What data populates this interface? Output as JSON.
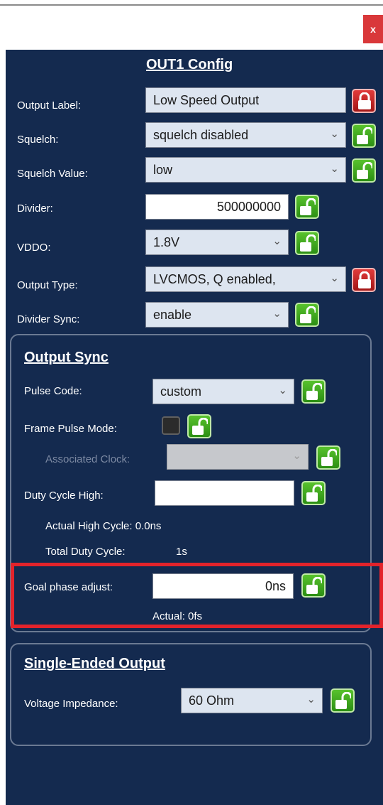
{
  "window": {
    "close_label": "x"
  },
  "panel": {
    "title": "OUT1 Config"
  },
  "fields": {
    "output_label": {
      "label": "Output Label:",
      "value": "Low Speed Output"
    },
    "squelch": {
      "label": "Squelch:",
      "value": "squelch disabled"
    },
    "squelch_value": {
      "label": "Squelch Value:",
      "value": "low"
    },
    "divider": {
      "label": "Divider:",
      "value": "500000000"
    },
    "vddo": {
      "label": "VDDO:",
      "value": "1.8V"
    },
    "output_type": {
      "label": "Output Type:",
      "value": "LVCMOS, Q enabled,"
    },
    "divider_sync": {
      "label": "Divider Sync:",
      "value": "enable"
    }
  },
  "output_sync": {
    "title": "Output Sync",
    "pulse_code": {
      "label": "Pulse Code:",
      "value": "custom"
    },
    "frame_pulse_mode": {
      "label": "Frame Pulse Mode:"
    },
    "associated_clock": {
      "label": "Associated Clock:",
      "value": ""
    },
    "duty_cycle_high": {
      "label": "Duty Cycle High:",
      "value": ""
    },
    "actual_high_cycle": {
      "label": "Actual High Cycle:",
      "value": "0.0ns"
    },
    "total_duty_cycle": {
      "label": "Total Duty Cycle:",
      "value": "1s"
    },
    "goal_phase_adjust": {
      "label": "Goal phase adjust:",
      "value": "0ns"
    },
    "actual": {
      "label": "Actual:",
      "value": "0fs"
    }
  },
  "single_ended": {
    "title": "Single-Ended Output",
    "voltage_impedance": {
      "label": "Voltage Impedance:",
      "value": "60 Ohm"
    }
  },
  "icons": {
    "chevron": "⌄",
    "lock_locked_color": "#c62222",
    "lock_unlocked_color": "#3aa81e"
  }
}
